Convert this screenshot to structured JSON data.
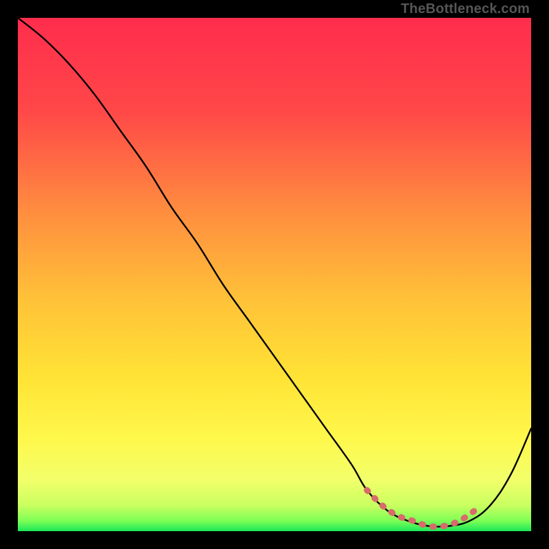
{
  "watermark": "TheBottleneck.com",
  "colors": {
    "background": "#000000",
    "curve": "#000000",
    "highlight": "#d86b6b",
    "green": "#19e859",
    "gradient_top": "#ff2d4d",
    "gradient_mid": "#ffcc33",
    "gradient_low": "#f4ff70",
    "watermark": "#565656"
  },
  "chart_data": {
    "type": "line",
    "title": "",
    "xlabel": "",
    "ylabel": "",
    "xlim": [
      0,
      100
    ],
    "ylim": [
      0,
      100
    ],
    "series": [
      {
        "name": "bottleneck-curve",
        "x": [
          0,
          5,
          10,
          15,
          20,
          25,
          30,
          35,
          40,
          45,
          50,
          55,
          60,
          65,
          68,
          72,
          76,
          80,
          84,
          88,
          92,
          96,
          100
        ],
        "y": [
          100,
          96,
          91,
          85,
          78,
          71,
          63,
          56,
          48,
          41,
          34,
          27,
          20,
          13,
          8,
          4,
          2,
          1,
          1,
          2,
          5,
          11,
          20
        ]
      }
    ],
    "highlight_segment": {
      "name": "optimal-range",
      "x": [
        68,
        71,
        74,
        77,
        80,
        83,
        86,
        89
      ],
      "y": [
        8,
        5,
        3,
        2,
        1,
        1,
        2,
        4
      ]
    }
  }
}
